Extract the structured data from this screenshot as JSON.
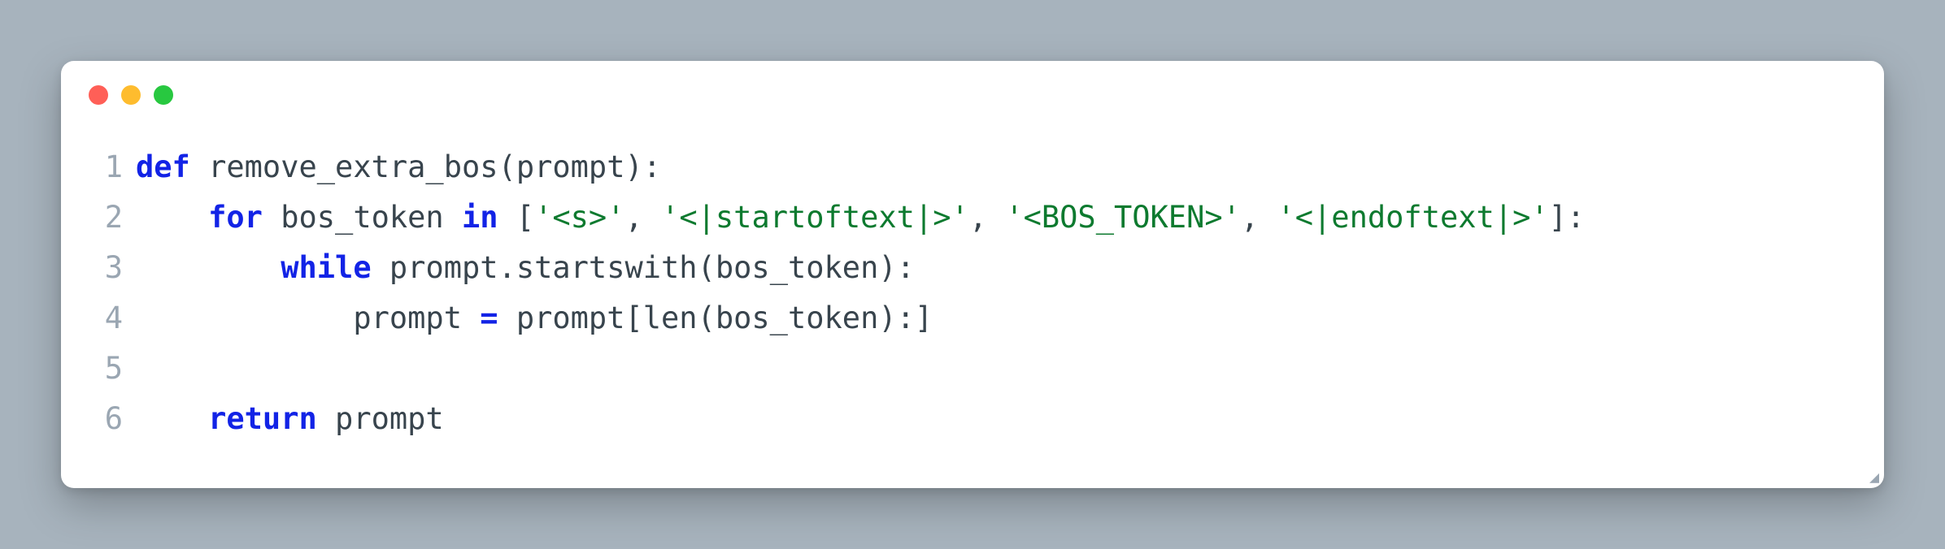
{
  "window": {
    "traffic": [
      "close",
      "minimize",
      "zoom"
    ]
  },
  "code": {
    "language": "python",
    "lines": [
      {
        "n": "1",
        "tokens": [
          {
            "cls": "kw",
            "t": "def"
          },
          {
            "cls": "pun",
            "t": " "
          },
          {
            "cls": "id",
            "t": "remove_extra_bos"
          },
          {
            "cls": "pun",
            "t": "("
          },
          {
            "cls": "id",
            "t": "prompt"
          },
          {
            "cls": "pun",
            "t": ")"
          },
          {
            "cls": "pun",
            "t": ":"
          }
        ]
      },
      {
        "n": "2",
        "tokens": [
          {
            "cls": "pun",
            "t": "    "
          },
          {
            "cls": "kw",
            "t": "for"
          },
          {
            "cls": "pun",
            "t": " "
          },
          {
            "cls": "id",
            "t": "bos_token"
          },
          {
            "cls": "pun",
            "t": " "
          },
          {
            "cls": "kw",
            "t": "in"
          },
          {
            "cls": "pun",
            "t": " "
          },
          {
            "cls": "pun",
            "t": "["
          },
          {
            "cls": "str",
            "t": "'<s>'"
          },
          {
            "cls": "pun",
            "t": ", "
          },
          {
            "cls": "str",
            "t": "'<|startoftext|>'"
          },
          {
            "cls": "pun",
            "t": ", "
          },
          {
            "cls": "str",
            "t": "'<BOS_TOKEN>'"
          },
          {
            "cls": "pun",
            "t": ", "
          },
          {
            "cls": "str",
            "t": "'<|endoftext|>'"
          },
          {
            "cls": "pun",
            "t": "]"
          },
          {
            "cls": "pun",
            "t": ":"
          }
        ]
      },
      {
        "n": "3",
        "tokens": [
          {
            "cls": "pun",
            "t": "        "
          },
          {
            "cls": "kw",
            "t": "while"
          },
          {
            "cls": "pun",
            "t": " "
          },
          {
            "cls": "id",
            "t": "prompt"
          },
          {
            "cls": "pun",
            "t": "."
          },
          {
            "cls": "id",
            "t": "startswith"
          },
          {
            "cls": "pun",
            "t": "("
          },
          {
            "cls": "id",
            "t": "bos_token"
          },
          {
            "cls": "pun",
            "t": ")"
          },
          {
            "cls": "pun",
            "t": ":"
          }
        ]
      },
      {
        "n": "4",
        "tokens": [
          {
            "cls": "pun",
            "t": "            "
          },
          {
            "cls": "id",
            "t": "prompt"
          },
          {
            "cls": "pun",
            "t": " "
          },
          {
            "cls": "op",
            "t": "="
          },
          {
            "cls": "pun",
            "t": " "
          },
          {
            "cls": "id",
            "t": "prompt"
          },
          {
            "cls": "pun",
            "t": "["
          },
          {
            "cls": "id",
            "t": "len"
          },
          {
            "cls": "pun",
            "t": "("
          },
          {
            "cls": "id",
            "t": "bos_token"
          },
          {
            "cls": "pun",
            "t": ")"
          },
          {
            "cls": "pun",
            "t": ":"
          },
          {
            "cls": "pun",
            "t": "]"
          }
        ]
      },
      {
        "n": "5",
        "tokens": [
          {
            "cls": "pun",
            "t": ""
          }
        ]
      },
      {
        "n": "6",
        "tokens": [
          {
            "cls": "pun",
            "t": "    "
          },
          {
            "cls": "kw",
            "t": "return"
          },
          {
            "cls": "pun",
            "t": " "
          },
          {
            "cls": "id",
            "t": "prompt"
          }
        ]
      }
    ]
  },
  "colors": {
    "background": "#a7b3bd",
    "panel": "#ffffff",
    "keyword": "#1223e6",
    "string": "#0d7a2f",
    "text": "#38444d",
    "gutter": "#9aa6b2",
    "traffic_red": "#ff5f57",
    "traffic_yellow": "#febc2e",
    "traffic_green": "#28c840"
  }
}
